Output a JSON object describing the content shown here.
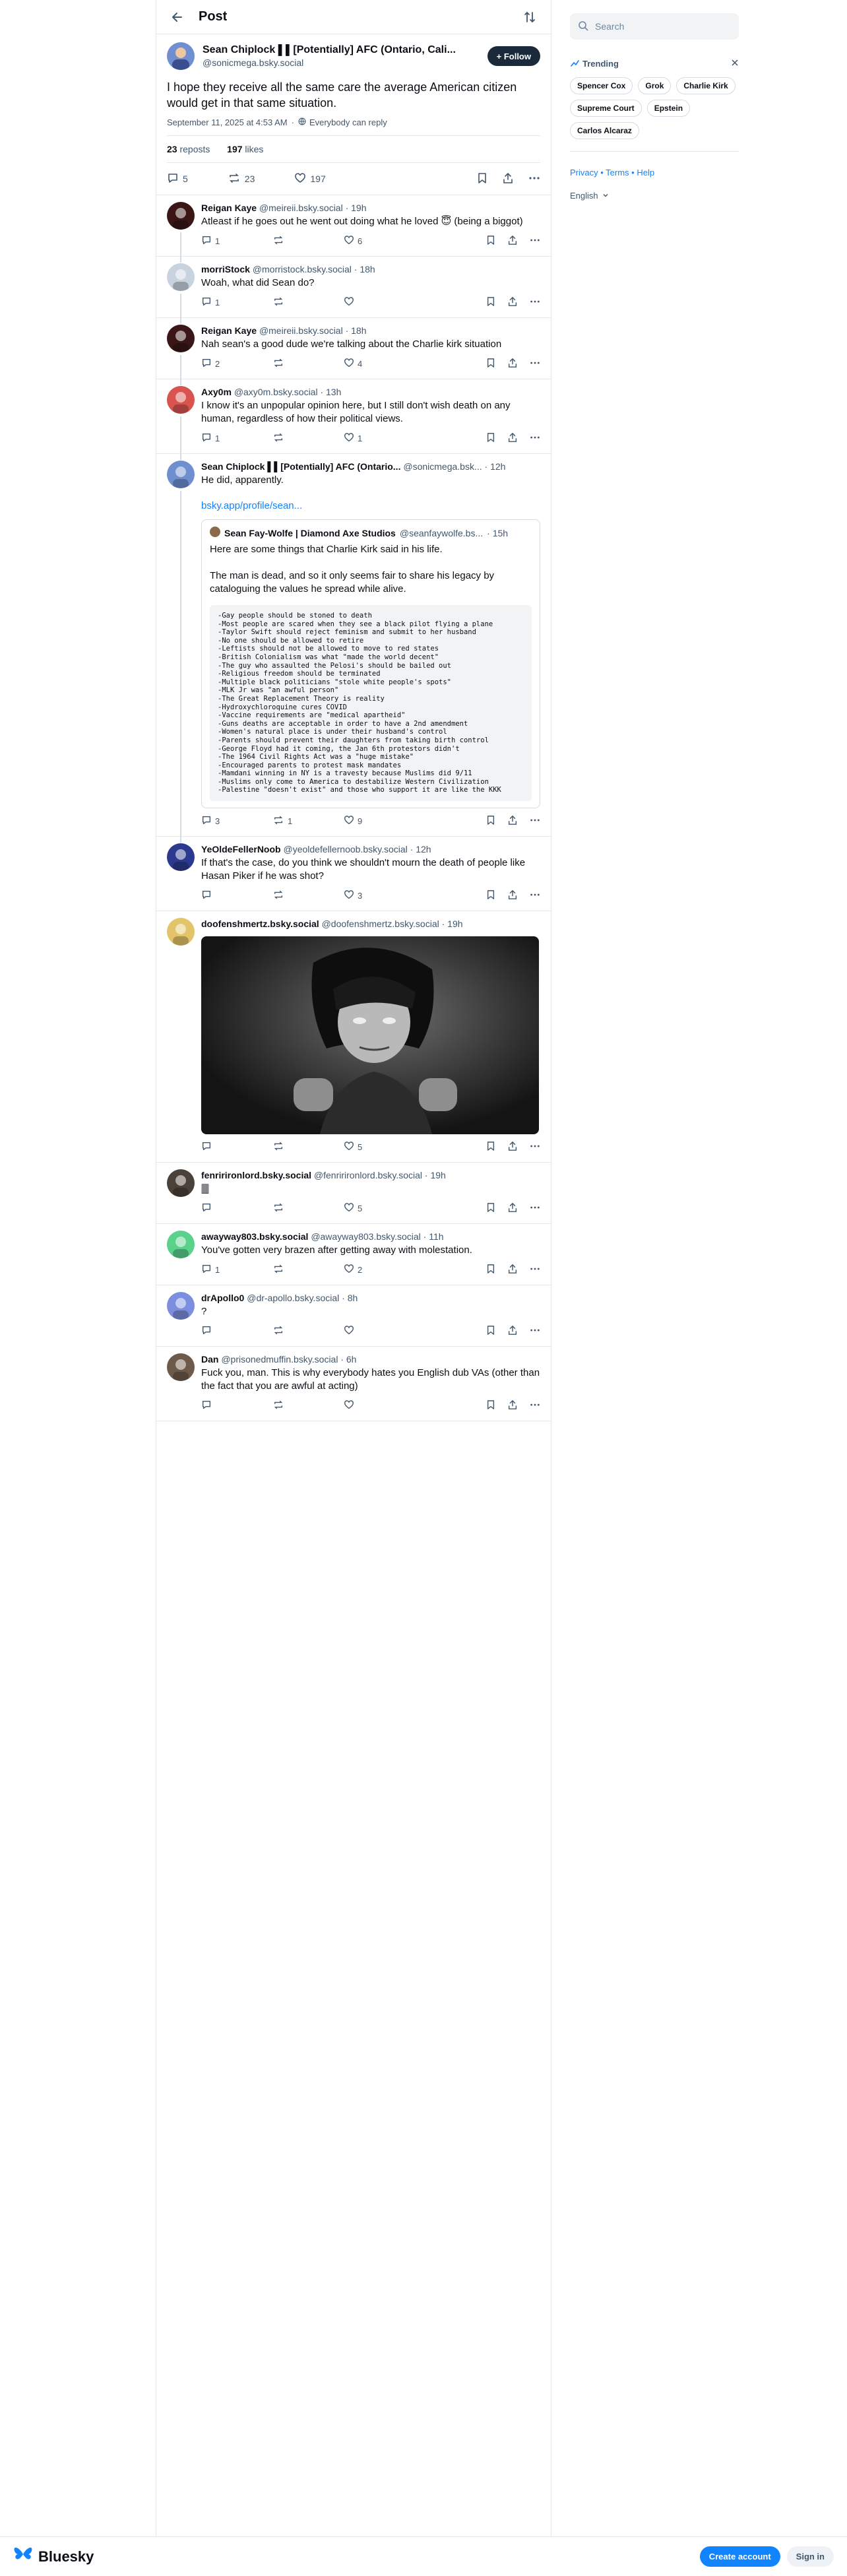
{
  "header": {
    "title": "Post"
  },
  "main_post": {
    "display_name": "Sean Chiplock ▌▌[Potentially] AFC (Ontario, Cali...",
    "handle": "@sonicmega.bsky.social",
    "follow_label": "+ Follow",
    "text": "I hope they receive all the same care the average American citizen would get in that same situation.",
    "timestamp": "September 11, 2025 at 4:53 AM",
    "reply_setting": "Everybody can reply",
    "reposts_count": "23",
    "reposts_label": "reposts",
    "likes_count": "197",
    "likes_label": "likes",
    "replies_action": "5",
    "reposts_action": "23",
    "likes_action": "197"
  },
  "replies": [
    {
      "name": "Reigan Kaye",
      "handle": "@meireii.bsky.social",
      "time": "· 19h",
      "text": "Atleast if he goes out he went out doing what he loved 😇 (being a biggot)",
      "replies": "1",
      "reposts": "",
      "likes": "6"
    },
    {
      "name": "morriStock",
      "handle": "@morristock.bsky.social",
      "time": "· 18h",
      "text": "Woah, what did Sean do?",
      "replies": "1",
      "reposts": "",
      "likes": ""
    },
    {
      "name": "Reigan Kaye",
      "handle": "@meireii.bsky.social",
      "time": "· 18h",
      "text": "Nah sean's a good dude we're talking about the Charlie kirk situation",
      "replies": "2",
      "reposts": "",
      "likes": "4"
    },
    {
      "name": "Axy0m",
      "handle": "@axy0m.bsky.social",
      "time": "· 13h",
      "text": "I know it's an unpopular opinion here, but I still don't wish death on any human, regardless of how their political views.",
      "replies": "1",
      "reposts": "",
      "likes": "1"
    },
    {
      "name": "Sean Chiplock ▌▌[Potentially] AFC (Ontario...",
      "handle": "@sonicmega.bsk...",
      "time": "· 12h",
      "text": "He did, apparently.",
      "link": "bsky.app/profile/sean...",
      "replies": "3",
      "reposts": "1",
      "likes": "9"
    },
    {
      "name": "YeOldeFellerNoob",
      "handle": "@yeoldefellernoob.bsky.social",
      "time": "· 12h",
      "text": "If that's the case, do you think we shouldn't mourn the death of people like Hasan Piker if he was shot?",
      "replies": "",
      "reposts": "",
      "likes": "3"
    },
    {
      "name": "doofenshmertz.bsky.social",
      "handle": "@doofenshmertz.bsky.social",
      "time": "· 19h",
      "text": "",
      "replies": "",
      "reposts": "",
      "likes": "5"
    },
    {
      "name": "fenririronlord.bsky.social",
      "handle": "@fenririronlord.bsky.social",
      "time": "· 19h",
      "text": "🀫",
      "replies": "",
      "reposts": "",
      "likes": "5"
    },
    {
      "name": "awayway803.bsky.social",
      "handle": "@awayway803.bsky.social",
      "time": "· 11h",
      "text": "You've gotten very brazen after getting away with molestation.",
      "replies": "1",
      "reposts": "",
      "likes": "2"
    },
    {
      "name": "drApollo0",
      "handle": "@dr-apollo.bsky.social",
      "time": "· 8h",
      "text": "?",
      "replies": "",
      "reposts": "",
      "likes": ""
    },
    {
      "name": "Dan",
      "handle": "@prisonedmuffin.bsky.social",
      "time": "· 6h",
      "text": "Fuck you, man. This is why everybody hates you English dub VAs (other than the fact that you are awful at acting)",
      "replies": "",
      "reposts": "",
      "likes": ""
    }
  ],
  "quote": {
    "name": "Sean Fay-Wolfe | Diamond Axe Studios",
    "handle": "@seanfaywolfe.bs...",
    "time": "· 15h",
    "text1": "Here are some things that Charlie Kirk said in his life.",
    "text2": "The man is dead, and so it only seems fair to share his legacy by cataloguing the values he spread while alive.",
    "list": "-Gay people should be stoned to death\n-Most people are scared when they see a black pilot flying a plane\n-Taylor Swift should reject feminism and submit to her husband\n-No one should be allowed to retire\n-Leftists should not be allowed to move to red states\n-British Colonialism was what \"made the world decent\"\n-The guy who assaulted the Pelosi's should be bailed out\n-Religious freedom should be terminated\n-Multiple black politicians \"stole white people's spots\"\n-MLK Jr was \"an awful person\"\n-The Great Replacement Theory is reality\n-Hydroxychloroquine cures COVID\n-Vaccine requirements are \"medical apartheid\"\n-Guns deaths are acceptable in order to have a 2nd amendment\n-Women's natural place is under their husband's control\n-Parents should prevent their daughters from taking birth control\n-George Floyd had it coming, the Jan 6th protestors didn't\n-The 1964 Civil Rights Act was a \"huge mistake\"\n-Encouraged parents to protest mask mandates\n-Mamdani winning in NY is a travesty because Muslims did 9/11\n-Muslims only come to America to destabilize Western Civilization\n-Palestine \"doesn't exist\" and those who support it are like the KKK"
  },
  "sidebar": {
    "search_placeholder": "Search",
    "trending_label": "Trending",
    "chips": [
      "Spencer Cox",
      "Grok",
      "Charlie Kirk",
      "Supreme Court",
      "Epstein",
      "Carlos Alcaraz"
    ],
    "links": "Privacy • Terms • Help",
    "language": "English"
  },
  "bottom_bar": {
    "brand": "Bluesky",
    "create_account": "Create account",
    "sign_in": "Sign in"
  },
  "colors": {
    "accent": "#1083fe",
    "muted": "#42576c",
    "border": "#e3e8ec"
  }
}
